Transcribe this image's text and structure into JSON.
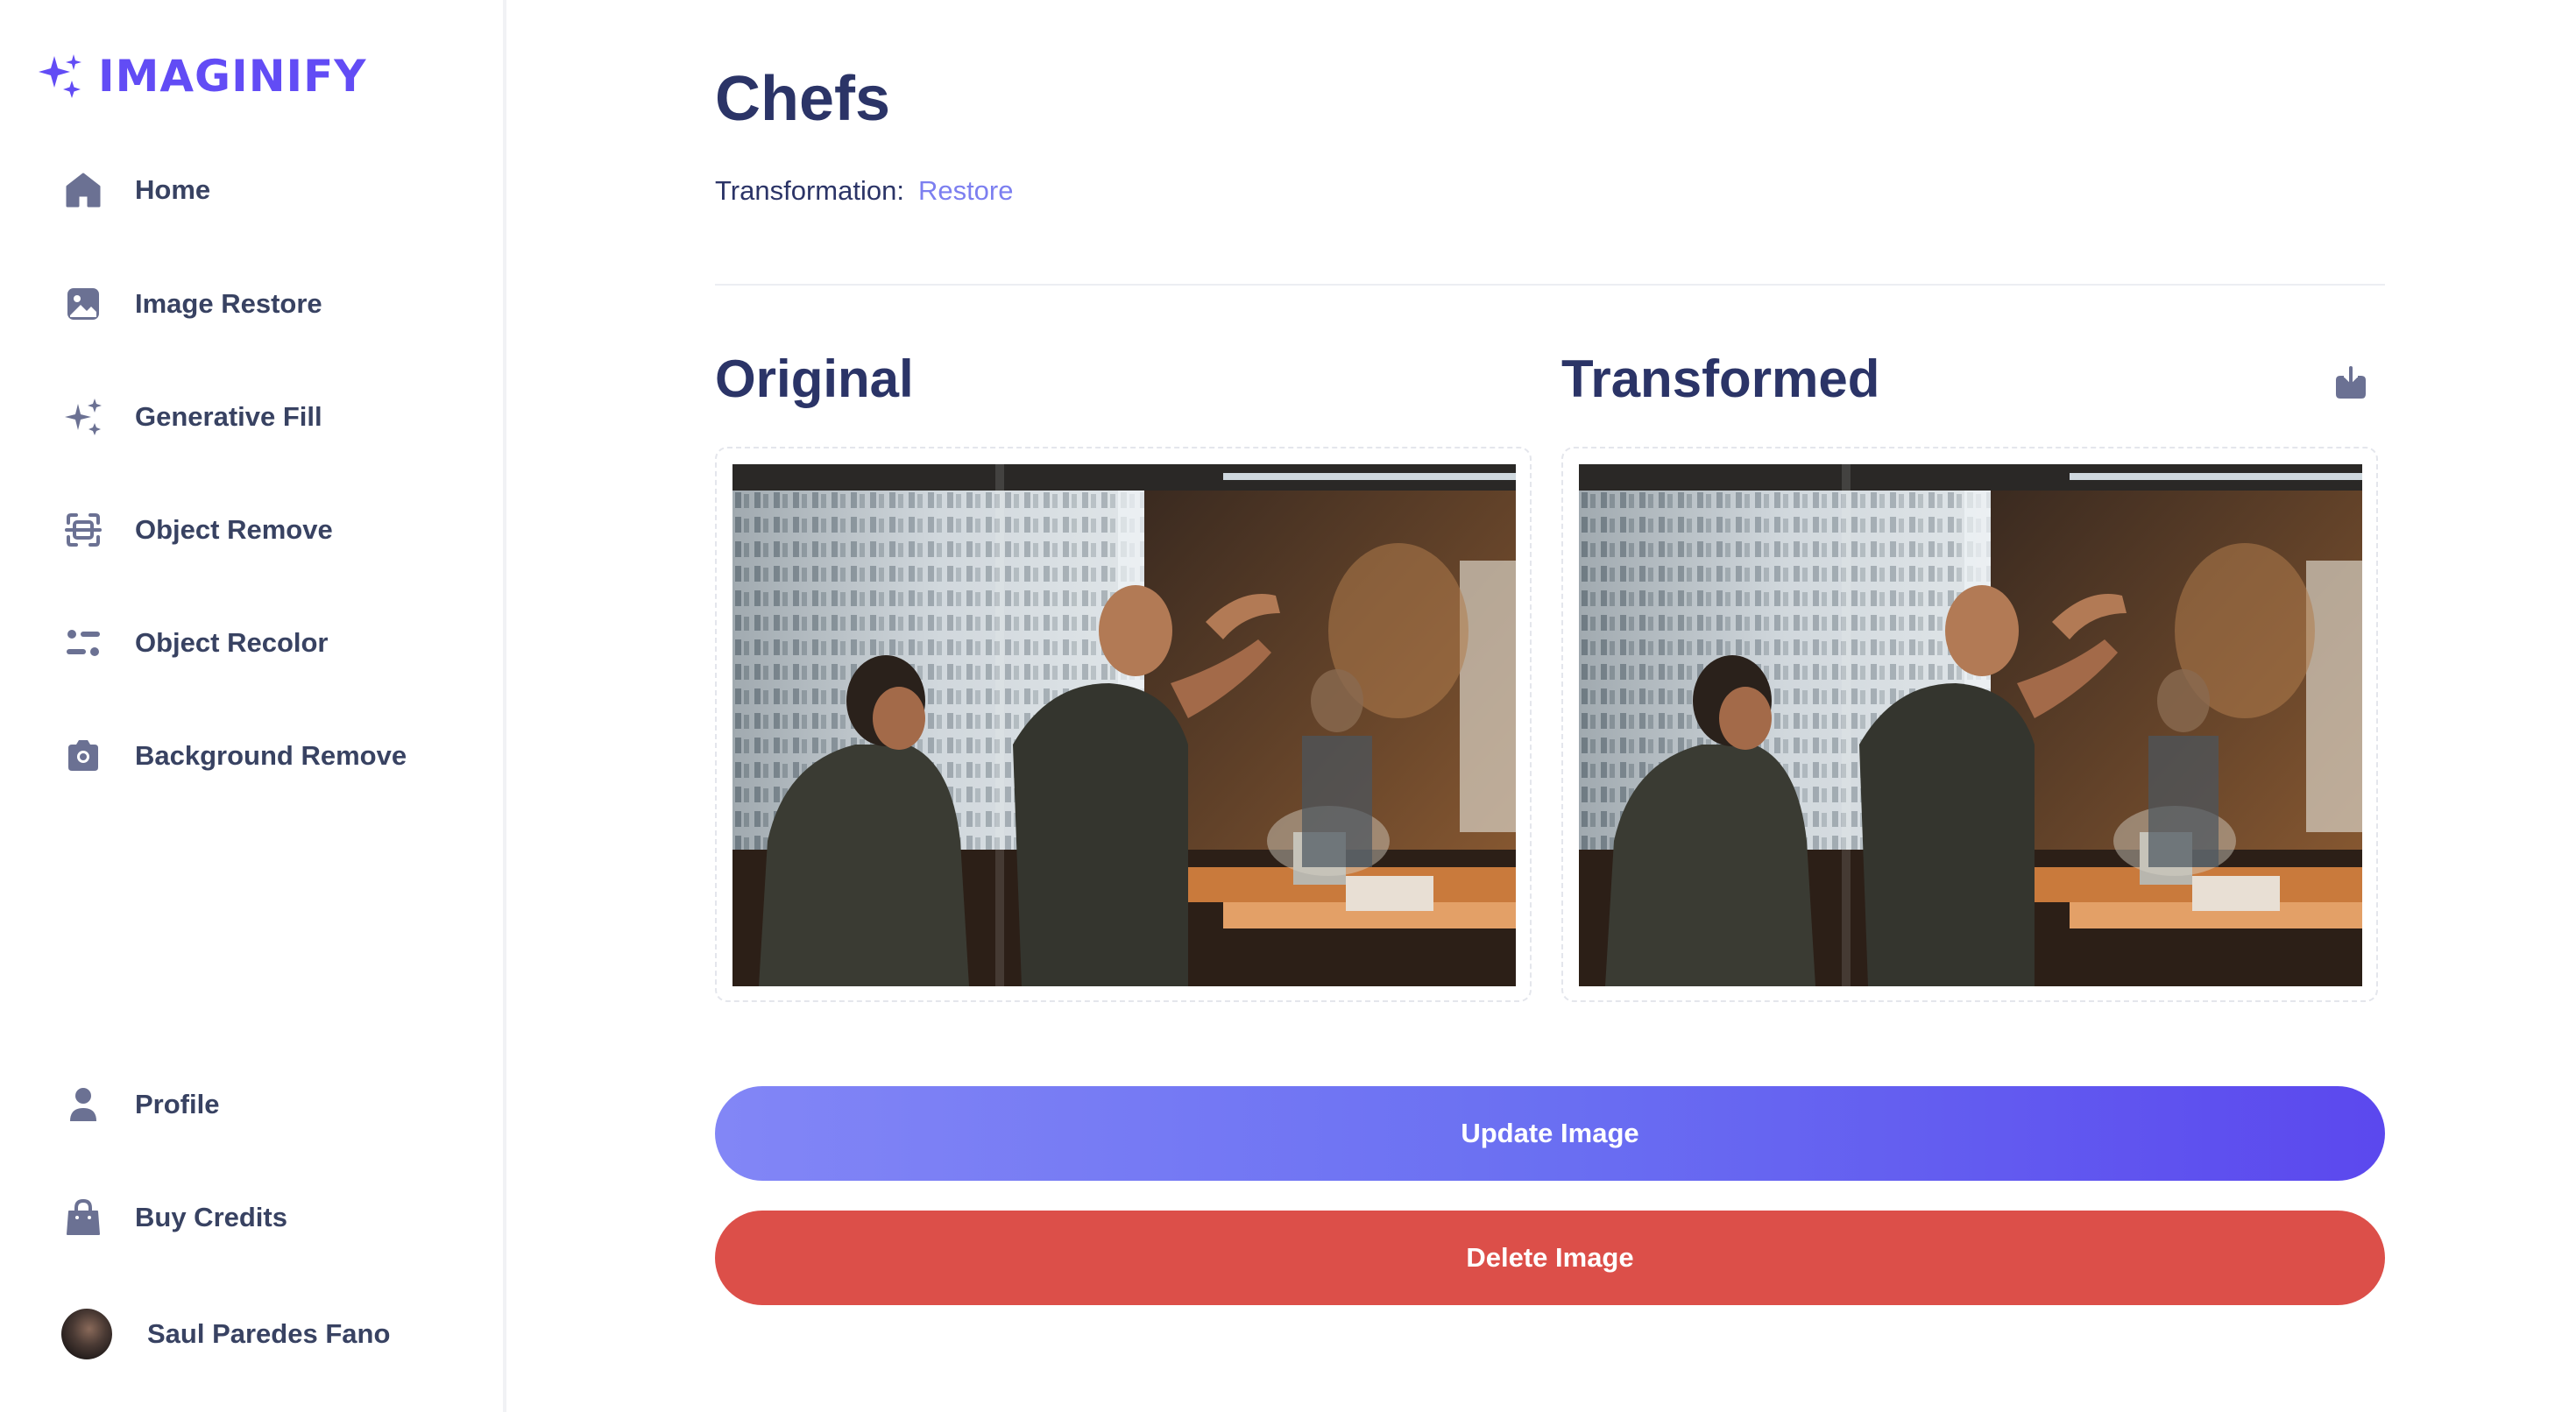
{
  "brand": {
    "name": "IMAGINIFY"
  },
  "sidebar": {
    "items": [
      {
        "label": "Home",
        "icon": "home-icon"
      },
      {
        "label": "Image Restore",
        "icon": "image-icon"
      },
      {
        "label": "Generative Fill",
        "icon": "stars-icon"
      },
      {
        "label": "Object Remove",
        "icon": "scan-icon"
      },
      {
        "label": "Object Recolor",
        "icon": "filter-icon"
      },
      {
        "label": "Background Remove",
        "icon": "camera-icon"
      }
    ],
    "bottom": [
      {
        "label": "Profile",
        "icon": "profile-icon"
      },
      {
        "label": "Buy Credits",
        "icon": "bag-icon"
      }
    ],
    "user": {
      "name": "Saul Paredes Fano"
    }
  },
  "page": {
    "title": "Chefs",
    "transformation_label": "Transformation:",
    "transformation_value": "Restore"
  },
  "panels": {
    "original_title": "Original",
    "transformed_title": "Transformed"
  },
  "actions": {
    "update_label": "Update Image",
    "delete_label": "Delete Image"
  },
  "colors": {
    "brand": "#624cf5",
    "heading": "#2b3467",
    "accent": "#7c7ff0",
    "update_gradient_start": "#8286f6",
    "update_gradient_end": "#5b48ee",
    "delete": "#dc4f49",
    "icon": "#6b7193"
  }
}
